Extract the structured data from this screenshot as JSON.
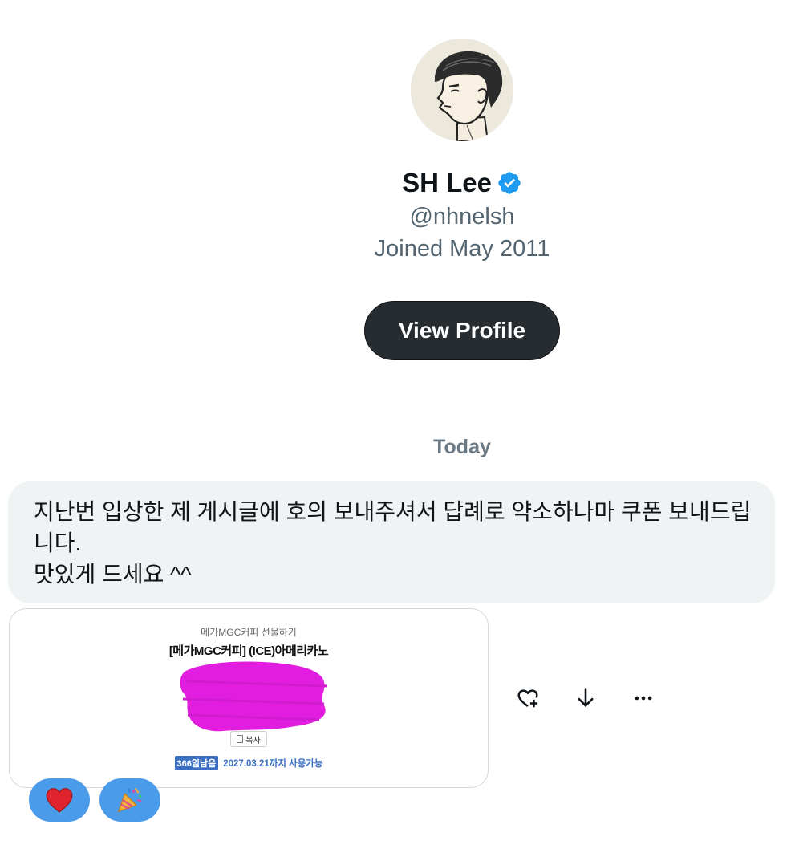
{
  "profile": {
    "name": "SH Lee",
    "handle": "@nhnelsh",
    "joined": "Joined May 2011",
    "verified": true,
    "view_profile_label": "View Profile"
  },
  "conversation": {
    "date_separator": "Today",
    "message_text": "지난번 입상한 제 게시글에 호의 보내주셔서 답례로 약소하나마 쿠폰 보내드립\n니다.\n맛있게 드세요 ^^",
    "coupon": {
      "subtitle": "메가MGC커피 선물하기",
      "title": "[메가MGC커피] (ICE)아메리카노",
      "copy_label": "복사",
      "days_left": "366일남음",
      "valid_until": "2027.03.21까지 사용가능"
    },
    "actions": [
      "heart-plus-icon",
      "download-arrow-icon",
      "more-icon"
    ],
    "reactions": [
      "❤️",
      "🎉"
    ]
  },
  "colors": {
    "verified_blue": "#1d9bf0",
    "reaction_blue": "#4a9bea",
    "button_dark": "#272c30",
    "bubble_bg": "#eff3f4",
    "redaction_magenta": "#e11ee0"
  }
}
